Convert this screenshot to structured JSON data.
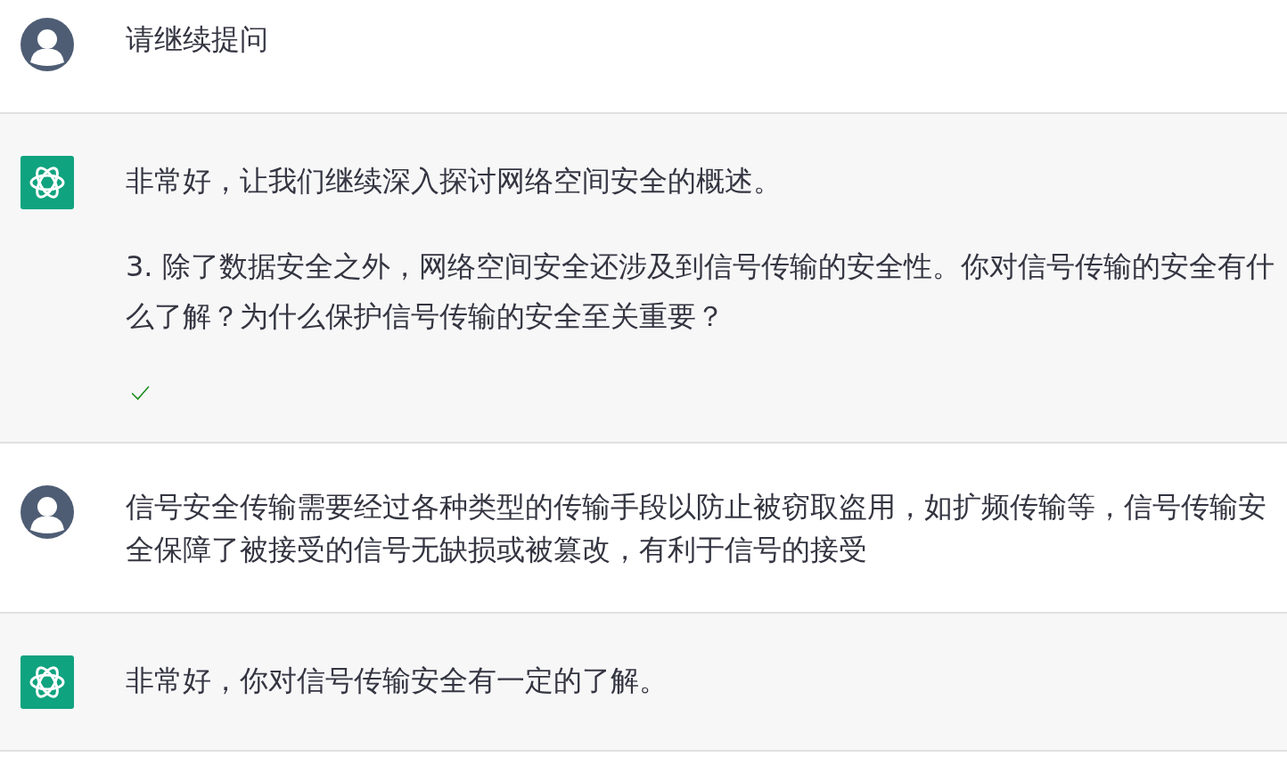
{
  "messages": [
    {
      "kind": "user",
      "paragraphs": [
        "请继续提问"
      ]
    },
    {
      "kind": "assistant",
      "paragraphs": [
        "非常好，让我们继续深入探讨网络空间安全的概述。",
        "3. 除了数据安全之外，网络空间安全还涉及到信号传输的安全性。你对信号传输的安全有什么了解？为什么保护信号传输的安全至关重要？"
      ],
      "checked": true
    },
    {
      "kind": "user",
      "paragraphs": [
        "信号安全传输需要经过各种类型的传输手段以防止被窃取盗用，如扩频传输等，信号传输安全保障了被接受的信号无缺损或被篡改，有利于信号的接受"
      ]
    },
    {
      "kind": "assistant",
      "paragraphs": [
        "非常好，你对信号传输安全有一定的了解。"
      ]
    }
  ]
}
